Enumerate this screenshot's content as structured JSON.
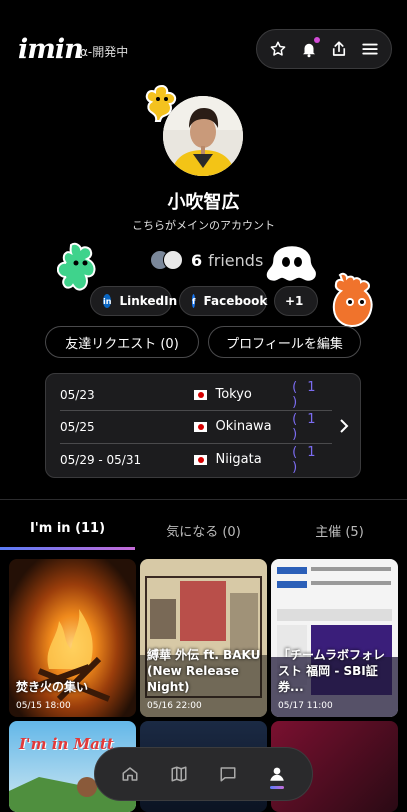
{
  "header": {
    "logo": "imin",
    "version_badge": "α-開発中",
    "actions": [
      "star-icon",
      "bell-icon",
      "share-icon",
      "menu-icon"
    ],
    "notification_dot_color": "#d24bd6"
  },
  "profile": {
    "name": "小吹智広",
    "subtitle": "こちらがメインのアカウント",
    "friends_count": "6",
    "friends_label": "friends"
  },
  "links": [
    {
      "label": "LinkedIn",
      "icon": "linkedin-icon"
    },
    {
      "label": "Facebook",
      "icon": "facebook-icon"
    },
    {
      "label": "+1",
      "icon": "chevron-right-icon"
    }
  ],
  "buttons": {
    "friend_requests": "友達リクエスト (0)",
    "edit_profile": "プロフィールを編集"
  },
  "trips": [
    {
      "dates": "05/23",
      "city": "Tokyo",
      "count": "( 1 )"
    },
    {
      "dates": "05/25",
      "city": "Okinawa",
      "count": "( 1 )"
    },
    {
      "dates": "05/29 - 05/31",
      "city": "Niigata",
      "count": "( 1 )"
    }
  ],
  "tabs": [
    {
      "label": "I'm in (11)",
      "active": true
    },
    {
      "label": "気になる (0)",
      "active": false
    },
    {
      "label": "主催 (5)",
      "active": false
    }
  ],
  "events": [
    {
      "title": "焚き火の集い",
      "date": "05/15 18:00"
    },
    {
      "title": "縛華 外伝 ft. BAKU (New Release Night)",
      "date": "05/16 22:00"
    },
    {
      "title": "「チームラボフォレスト 福岡 - SBI証券...",
      "date": "05/17 11:00"
    },
    {
      "title": "I'm in Matt",
      "date": ""
    }
  ],
  "bottom_nav": [
    "home-icon",
    "map-icon",
    "chat-icon",
    "profile-icon"
  ],
  "colors": {
    "accent_start": "#5b7cf7",
    "accent_end": "#c56bd8",
    "count_purple": "#7b6cf0"
  }
}
